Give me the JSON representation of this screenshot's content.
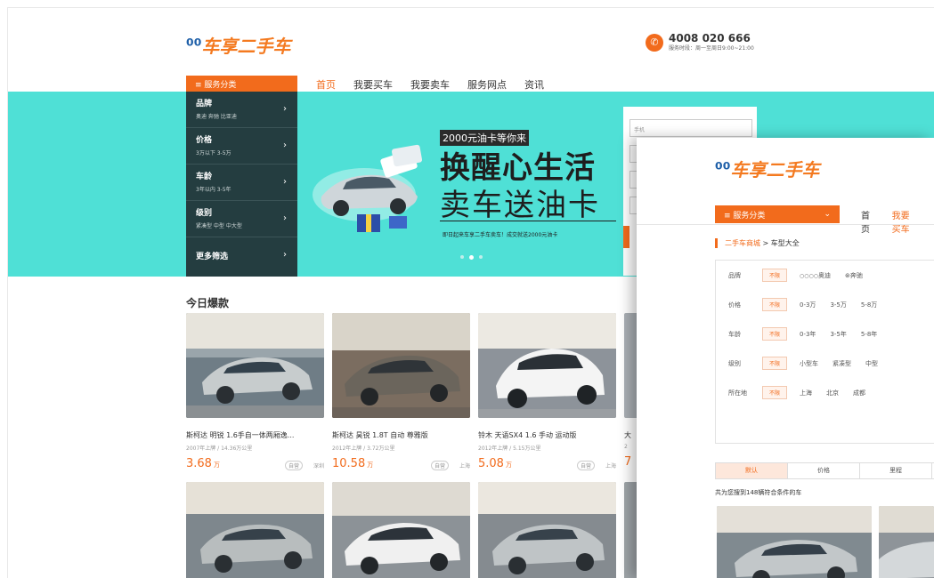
{
  "header": {
    "logo_mark": "⁰⁰",
    "logo_text": "车享二手车",
    "phone_icon": "phone-icon",
    "phone": "4008 020 666",
    "hours": "服务时段：周一至周日9:00~21:00"
  },
  "nav": {
    "category_button": "≡ 服务分类",
    "items": [
      "首页",
      "我要买车",
      "我要卖车",
      "服务网点",
      "资讯"
    ]
  },
  "sidebar": {
    "items": [
      {
        "title": "品牌",
        "sub": "奥迪  奔驰  比亚迪"
      },
      {
        "title": "价格",
        "sub": "3万以下  3-5万"
      },
      {
        "title": "车龄",
        "sub": "3年以内  3-5年"
      },
      {
        "title": "级别",
        "sub": "紧凑型  中型  中大型"
      },
      {
        "title": "更多筛选",
        "sub": ""
      }
    ]
  },
  "banner": {
    "tag": "2000元油卡等你来",
    "headline": "换醒心生活",
    "subline": "卖车送油卡",
    "note": "即日起来车享二手车卖车！成交就送2000元油卡",
    "bg_color": "#4fe0d6",
    "carousel_active": 1
  },
  "form": {
    "phone_placeholder": "手机"
  },
  "section": {
    "title": "今日爆款"
  },
  "cars": [
    {
      "name": "斯柯达 明锐 1.6手自一体两厢逸...",
      "sub": "2007年上牌 / 14.36万公里",
      "price": "3.68",
      "unit": "万",
      "tag": "自营",
      "city": "深圳"
    },
    {
      "name": "斯柯达 昊锐 1.8T 自动 尊雅版",
      "sub": "2012年上牌 / 3.72万公里",
      "price": "10.58",
      "unit": "万",
      "tag": "自营",
      "city": "上海"
    },
    {
      "name": "铃木 天语SX4 1.6 手动 运动版",
      "sub": "2012年上牌 / 5.15万公里",
      "price": "5.08",
      "unit": "万",
      "tag": "自营",
      "city": "上海"
    },
    {
      "name": "大",
      "sub": "2",
      "price": "7",
      "unit": "",
      "tag": "",
      "city": ""
    }
  ],
  "overlay": {
    "logo_mark": "⁰⁰",
    "logo_text": "车享二手车",
    "category_button": "≡ 服务分类",
    "chevron": "chevron-down-icon",
    "nav": [
      "首页",
      "我要买车"
    ],
    "breadcrumb_link": "二手车商城",
    "breadcrumb_current": " > 车型大全",
    "filters": [
      {
        "label": "品牌",
        "unlimited": "不限",
        "options": [
          "奥迪",
          "奔驰"
        ]
      },
      {
        "label": "价格",
        "unlimited": "不限",
        "options": [
          "0-3万",
          "3-5万",
          "5-8万"
        ]
      },
      {
        "label": "车龄",
        "unlimited": "不限",
        "options": [
          "0-3年",
          "3-5年",
          "5-8年"
        ]
      },
      {
        "label": "级别",
        "unlimited": "不限",
        "options": [
          "小型车",
          "紧凑型",
          "中型"
        ]
      },
      {
        "label": "所在地",
        "unlimited": "不限",
        "options": [
          "上海",
          "北京",
          "成都"
        ]
      }
    ],
    "sort": [
      "默认",
      "价格",
      "里程"
    ],
    "count_text": "共为您搜到148辆符合条件的车"
  }
}
